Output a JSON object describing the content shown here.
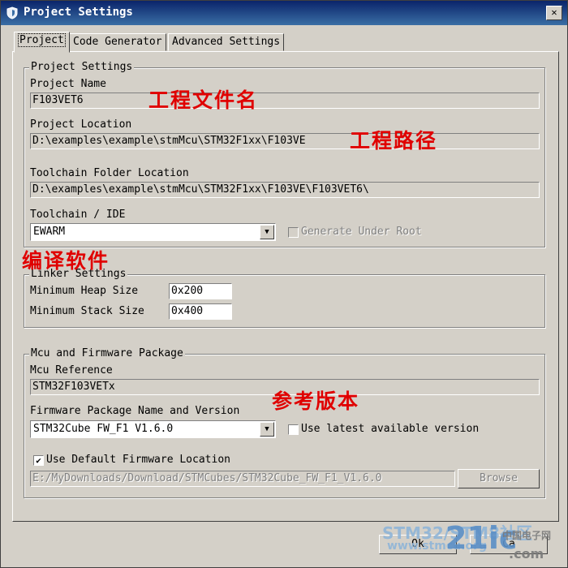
{
  "window": {
    "title": "Project Settings",
    "close_label": "✕"
  },
  "tabs": [
    {
      "label": "Project",
      "active": true
    },
    {
      "label": "Code Generator",
      "active": false
    },
    {
      "label": "Advanced Settings",
      "active": false
    }
  ],
  "project_settings": {
    "legend": "Project Settings",
    "name_label": "Project Name",
    "name_value": "F103VET6",
    "location_label": "Project Location",
    "location_value": "D:\\examples\\example\\stmMcu\\STM32F1xx\\F103VE",
    "toolchain_folder_label": "Toolchain Folder Location",
    "toolchain_folder_value": "D:\\examples\\example\\stmMcu\\STM32F1xx\\F103VE\\F103VET6\\",
    "toolchain_label": "Toolchain / IDE",
    "toolchain_value": "EWARM",
    "generate_under_root_label": "Generate Under Root",
    "generate_under_root_checked": false
  },
  "linker_settings": {
    "legend": "Linker Settings",
    "heap_label": "Minimum Heap Size",
    "heap_value": "0x200",
    "stack_label": "Minimum Stack Size",
    "stack_value": "0x400"
  },
  "mcu_firmware": {
    "legend": "Mcu and Firmware Package",
    "mcu_ref_label": "Mcu Reference",
    "mcu_ref_value": "STM32F103VETx",
    "fw_name_label": "Firmware Package Name and Version",
    "fw_name_value": "STM32Cube FW_F1 V1.6.0",
    "use_latest_label": "Use latest available version",
    "use_latest_checked": false,
    "use_default_location_label": "Use Default Firmware Location",
    "use_default_location_checked": true,
    "fw_location_value": "E:/MyDownloads/Download/STMCubes/STM32Cube_FW_F1_V1.6.0",
    "browse_label": "Browse"
  },
  "footer": {
    "ok_label": "Ok",
    "cancel_label": "Ca"
  },
  "annotations": {
    "project_name": "工程文件名",
    "project_path": "工程路径",
    "toolchain": "编译软件",
    "firmware": "参考版本"
  },
  "watermark": {
    "line1": "STM32/STM8社区",
    "line2": "www.stmcu.org",
    "brand": "21ic",
    "brand_sub": "中国电子网",
    "brand_domain": ".com"
  },
  "colors": {
    "annotation": "#e00000",
    "titlebar": "#0a246a",
    "watermark": "#8fb5d8"
  }
}
